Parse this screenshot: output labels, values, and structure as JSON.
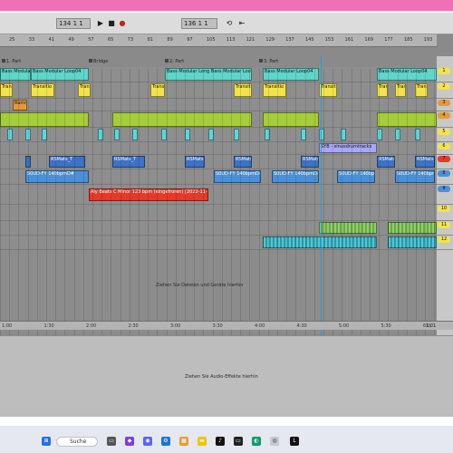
{
  "transport": {
    "tempo": "134",
    "signature": "1 1",
    "position": "136 1 1",
    "play_icon": "play-icon",
    "stop_icon": "stop-icon",
    "record_icon": "record-icon"
  },
  "ruler_ticks": [
    "25",
    "33",
    "41",
    "49",
    "57",
    "65",
    "73",
    "81",
    "89",
    "97",
    "105",
    "113",
    "121",
    "129",
    "137",
    "145",
    "153",
    "161",
    "169",
    "177",
    "185",
    "193"
  ],
  "locators": [
    "1. Part",
    "Bridge",
    "2. Part",
    "3. Part"
  ],
  "clips": {
    "bass1": "Bass Modular Long",
    "bass2": "Bass Modular Loop04",
    "bass3": "Bass Modular Long Bass Modular Loop04",
    "bass4": "Bass Modular Loop04",
    "bass5": "Bass Modular Loop04",
    "transit": "Transitio",
    "red_clip": "Aly Beats C Minor 123 bpm (eingefroren) [2022-11-30 1044]",
    "blue1": "S0UD-FY 140bpmD#",
    "blue2": "S0UD-FY 140bpmD#",
    "blue3": "S0UD-FY 140bpmD#",
    "purple": "SYB - sinusdrumtracks",
    "rsmats": "RSMats_T",
    "orange": "Ramm"
  },
  "hints": {
    "drop_files": "Ziehen Sie Dateien und Geräte hierhin",
    "drop_effects": "Ziehen Sie Audio-Effekte hierhin"
  },
  "timebar": [
    "1:00",
    "1:30",
    "2:00",
    "2:30",
    "3:00",
    "3:30",
    "4:00",
    "4:30",
    "5:00",
    "5:30",
    "6:00"
  ],
  "page_indicator": "1 / 1",
  "track_numbers": [
    "1",
    "2",
    "3",
    "4",
    "5",
    "6",
    "7",
    "8",
    "9",
    "10",
    "11",
    "12"
  ],
  "taskbar": {
    "search_label": "Suche"
  }
}
